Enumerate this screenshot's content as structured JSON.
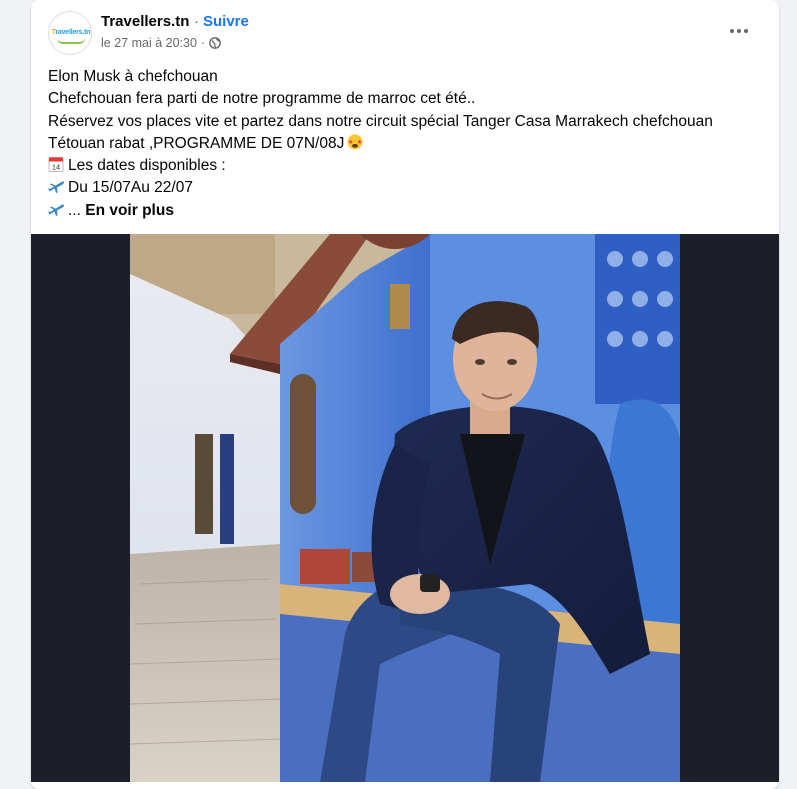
{
  "post": {
    "page_name": "Travellers.tn",
    "separator": "·",
    "follow_label": "Suivre",
    "timestamp": "le 27 mai à 20:30",
    "meta_dot": "·",
    "privacy_icon": "globe-icon",
    "avatar_logo_text_a": "T",
    "avatar_logo_text_b": "ravellers.tn",
    "lines": [
      "Elon Musk à chefchouan",
      "Chefchouan fera parti de notre programme de marroc cet été..",
      "Réservez vos places vite et partez dans notre circuit spécial Tanger Casa Marrakech chefchouan",
      "Tétouan rabat ,PROGRAMME DE 07N/08J"
    ],
    "dates_label": "Les dates disponibles :",
    "date_range": "Du 15/07Au 22/07",
    "ellipsis": "...",
    "see_more": "En voir plus",
    "calendar_day": "14"
  },
  "colors": {
    "link_blue": "#1877f2",
    "secondary_text": "#65676b",
    "media_background": "#1c1e2a"
  }
}
